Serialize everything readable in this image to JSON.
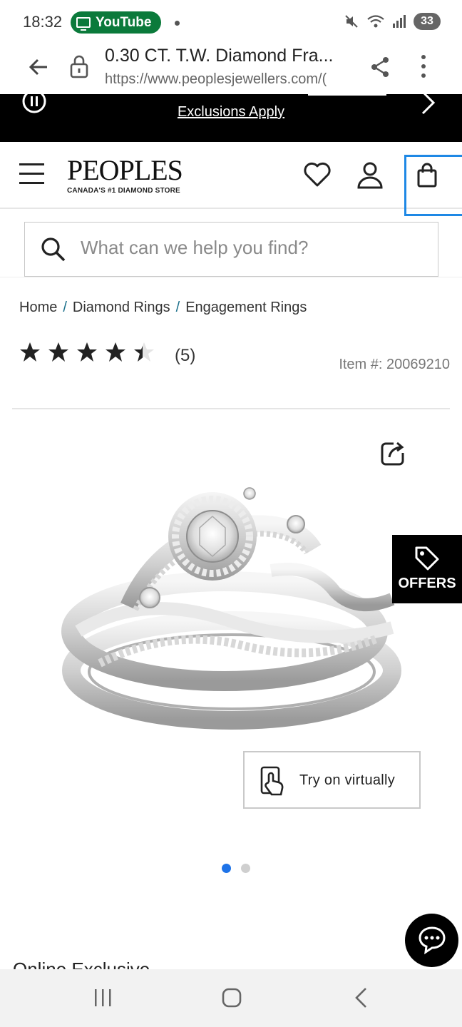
{
  "status_bar": {
    "time": "18:32",
    "app_pill": "YouTube",
    "battery": "33",
    "icons": [
      "mute-icon",
      "wifi-icon",
      "signal-icon",
      "battery-icon"
    ]
  },
  "browser": {
    "page_title": "0.30 CT. T.W. Diamond Fra...",
    "url": "https://www.peoplesjewellers.com/(",
    "icons": [
      "back-arrow-icon",
      "lock-icon",
      "share-icon",
      "overflow-menu-icon"
    ]
  },
  "promo": {
    "link_text": "Exclusions Apply"
  },
  "header": {
    "logo_text": "PEOPLES",
    "logo_tagline": "CANADA'S #1 DIAMOND STORE",
    "icons": [
      "hamburger-menu-icon",
      "heart-icon",
      "account-icon",
      "shopping-bag-icon"
    ]
  },
  "search": {
    "placeholder": "What can we help you find?"
  },
  "breadcrumb": {
    "items": [
      "Home",
      "Diamond Rings",
      "Engagement Rings"
    ],
    "separator": "/"
  },
  "rating": {
    "stars": 4.5,
    "max": 5,
    "count_text": "(5)"
  },
  "item_number": "Item #: 20069210",
  "product": {
    "offers_label": "OFFERS",
    "try_on_label": "Try on virtually",
    "carousel": {
      "count": 2,
      "active_index": 0
    },
    "section_heading": "Online Exclusive"
  },
  "colors": {
    "accent_blue": "#1e88e5",
    "youtube_green": "#0b7a3b",
    "banner_black": "#000000"
  }
}
